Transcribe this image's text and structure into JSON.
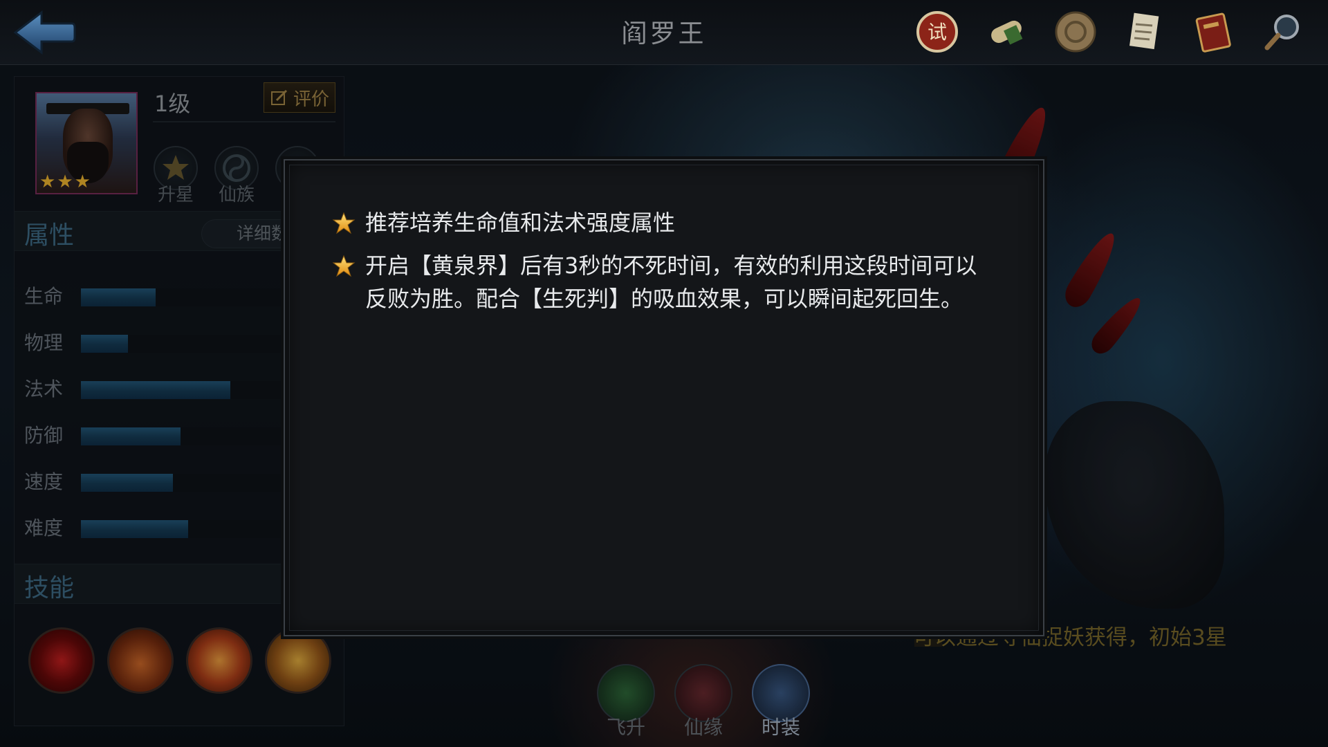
{
  "header": {
    "title": "阎罗王",
    "icons": [
      "trial-seal-icon",
      "scroll-icon",
      "medallion-icon",
      "document-icon",
      "book-icon",
      "magnifier-icon"
    ]
  },
  "hero": {
    "level": "1级",
    "stars": 3,
    "review_label": "评价",
    "buttons": [
      "升星",
      "仙族"
    ]
  },
  "attributes": {
    "title": "属性",
    "detail_label": "详细数",
    "stats": [
      {
        "label": "生命",
        "value": 0.3
      },
      {
        "label": "物理",
        "value": 0.19
      },
      {
        "label": "法术",
        "value": 0.6
      },
      {
        "label": "防御",
        "value": 0.4
      },
      {
        "label": "速度",
        "value": 0.37
      },
      {
        "label": "难度",
        "value": 0.43
      }
    ]
  },
  "skills": {
    "title": "技能",
    "icons": [
      "skill-blood-icon",
      "skill-claw-icon",
      "skill-flame-strike-icon",
      "skill-fire-swirl-icon"
    ]
  },
  "bottom_nav": {
    "items": [
      "飞升",
      "仙缘",
      "时装"
    ],
    "acquire_tip": "可以通过寻仙捉妖获得，初始3星"
  },
  "modal": {
    "tip1": "推荐培养生命值和法术强度属性",
    "tip2": "开启【黄泉界】后有3秒的不死时间，有效的利用这段时间可以反败为胜。配合【生死判】的吸血效果，可以瞬间起死回生。"
  },
  "colors": {
    "accent_blue": "#3f6d88",
    "star_gold": "#f2b830",
    "tip_gold": "#7c6a2c"
  }
}
